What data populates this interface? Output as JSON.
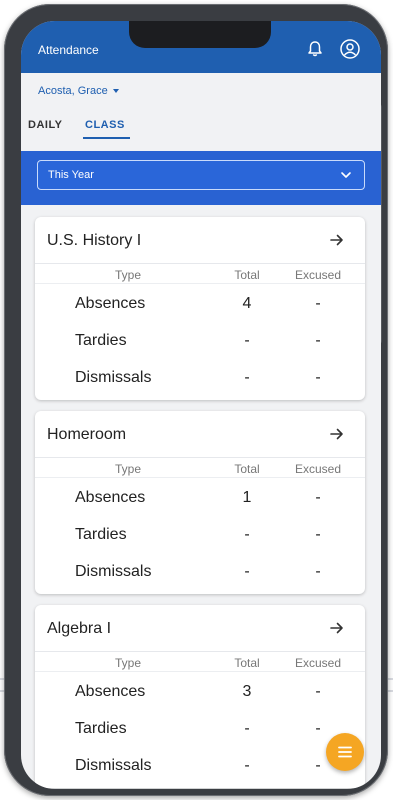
{
  "app": {
    "title": "Attendance"
  },
  "student": {
    "name": "Acosta, Grace"
  },
  "tabs": [
    {
      "label": "DAILY",
      "active": false
    },
    {
      "label": "CLASS",
      "active": true
    }
  ],
  "filter": {
    "selected": "This Year"
  },
  "columns": {
    "type": "Type",
    "total": "Total",
    "excused": "Excused"
  },
  "classes": [
    {
      "name": "U.S. History I",
      "rows": [
        {
          "type": "Absences",
          "total": "4",
          "excused": "-"
        },
        {
          "type": "Tardies",
          "total": "-",
          "excused": "-"
        },
        {
          "type": "Dismissals",
          "total": "-",
          "excused": "-"
        }
      ]
    },
    {
      "name": "Homeroom",
      "rows": [
        {
          "type": "Absences",
          "total": "1",
          "excused": "-"
        },
        {
          "type": "Tardies",
          "total": "-",
          "excused": "-"
        },
        {
          "type": "Dismissals",
          "total": "-",
          "excused": "-"
        }
      ]
    },
    {
      "name": "Algebra I",
      "rows": [
        {
          "type": "Absences",
          "total": "3",
          "excused": "-"
        },
        {
          "type": "Tardies",
          "total": "-",
          "excused": "-"
        },
        {
          "type": "Dismissals",
          "total": "-",
          "excused": "-"
        }
      ]
    }
  ],
  "icons": {
    "notifications": "bell-icon",
    "profile": "user-circle-icon",
    "open_class": "arrow-right-icon",
    "dropdown": "chevron-down-icon",
    "fab": "menu-lines-icon"
  },
  "colors": {
    "app_bar": "#1f5fb0",
    "filter_band": "#2962d2",
    "accent": "#1f5fb0",
    "fab": "#f5a623"
  }
}
